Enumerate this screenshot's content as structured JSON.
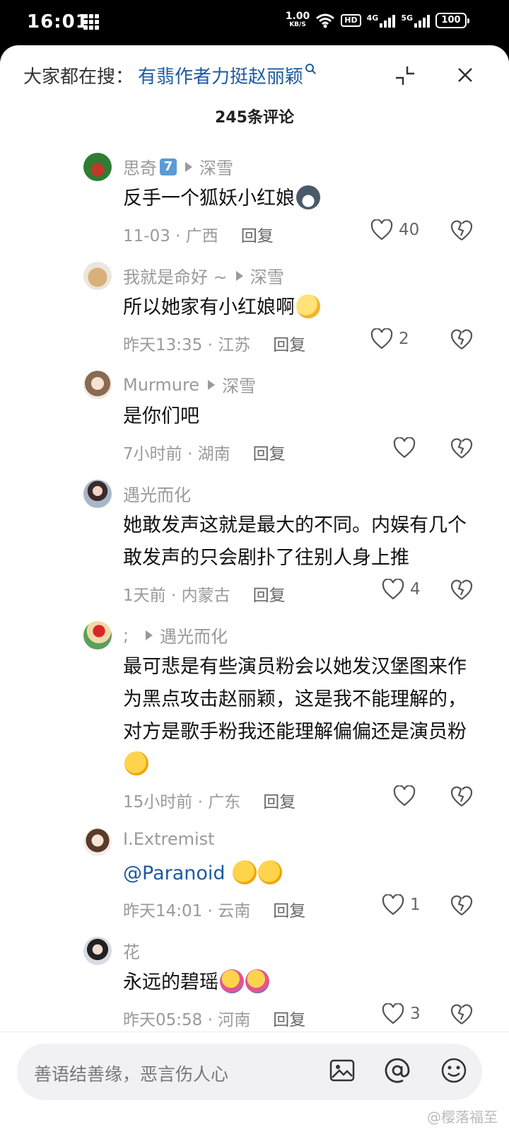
{
  "status": {
    "time": "16:01",
    "speed_value": "1.00",
    "speed_unit": "KB/S",
    "hd": "HD",
    "net1": "4G",
    "net2": "5G",
    "battery": "100"
  },
  "header": {
    "search_prefix": "大家都在搜：",
    "hot_search": "有翡作者力挺赵丽颖",
    "comment_count": "245条评论"
  },
  "comments": [
    {
      "user": "思奇",
      "user_badge": "7",
      "reply_to": "深雪",
      "text": "反手一个狐妖小红娘",
      "meta": "11-03 · 广西",
      "reply_label": "回复",
      "likes": "40"
    },
    {
      "user": "我就是命好 ~",
      "reply_to": "深雪",
      "text": "所以她家有小红娘啊",
      "meta": "昨天13:35 · 江苏",
      "reply_label": "回复",
      "likes": "2"
    },
    {
      "user": "Murmure",
      "reply_to": "深雪",
      "text": "是你们吧",
      "meta": "7小时前 · 湖南",
      "reply_label": "回复",
      "likes": ""
    },
    {
      "user": "遇光而化",
      "text": "她敢发声这就是最大的不同。内娱有几个敢发声的只会剧扑了往别人身上推",
      "meta": "1天前 · 内蒙古",
      "reply_label": "回复",
      "likes": "4"
    },
    {
      "user": ";",
      "reply_to": "遇光而化",
      "text": "最可悲是有些演员粉会以她发汉堡图来作为黑点攻击赵丽颖，这是我不能理解的，对方是歌手粉我还能理解偏偏还是演员粉",
      "meta": "15小时前 · 广东",
      "reply_label": "回复",
      "likes": ""
    },
    {
      "user": "I.Extremist",
      "text": "@Paranoid",
      "meta": "昨天14:01 · 云南",
      "reply_label": "回复",
      "likes": "1"
    },
    {
      "user": "花",
      "text": "永远的碧瑶",
      "meta": "昨天05:58 · 河南",
      "reply_label": "回复",
      "likes": "3"
    }
  ],
  "input": {
    "placeholder": "善语结善缘，恶言伤人心"
  },
  "watermark": "@樱落福至",
  "icons": [
    "search-icon",
    "collapse-icon",
    "close-icon",
    "heart-icon",
    "broken-heart-icon",
    "image-icon",
    "at-icon",
    "emoji-icon"
  ],
  "colors": {
    "accent": "#1d5a9e",
    "meta": "#9a9a9a",
    "text": "#111111"
  }
}
